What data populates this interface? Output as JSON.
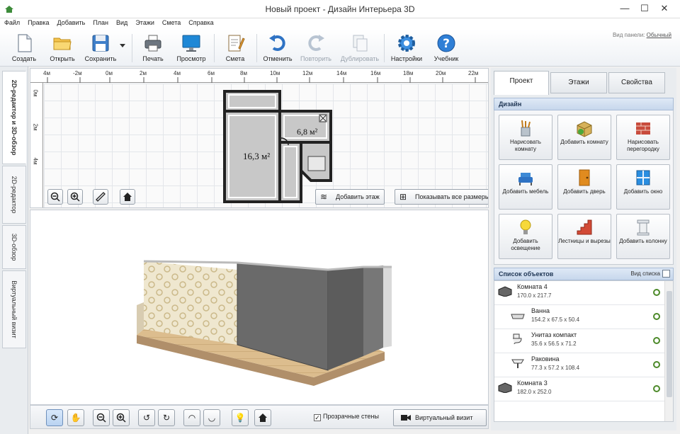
{
  "window": {
    "title": "Новый проект - Дизайн Интерьера 3D",
    "minimize": "—",
    "maximize": "☐",
    "close": "✕"
  },
  "menu": [
    "Файл",
    "Правка",
    "Добавить",
    "План",
    "Вид",
    "Этажи",
    "Смета",
    "Справка"
  ],
  "toolbar": {
    "create": "Создать",
    "open": "Открыть",
    "save": "Сохранить",
    "print": "Печать",
    "preview": "Просмотр",
    "estimate": "Смета",
    "undo": "Отменить",
    "redo": "Повторить",
    "duplicate": "Дублировать",
    "settings": "Настройки",
    "tutorial": "Учебник",
    "panel_view_label": "Вид панели:",
    "panel_view_value": "Обычный"
  },
  "left_tabs": [
    "2D-редактор и 3D-обзор",
    "2D-редактор",
    "3D-обзор",
    "Виртуальный визит"
  ],
  "plan": {
    "ruler_top": [
      "4м",
      "-2м",
      "0м",
      "2м",
      "4м",
      "6м",
      "8м",
      "10м",
      "12м",
      "14м",
      "16м",
      "18м",
      "20м",
      "22м"
    ],
    "ruler_left": [
      "0м",
      "2м",
      "4м"
    ],
    "room_labels": [
      "16,3 м²",
      "6,8 м²"
    ],
    "add_floor": "Добавить этаж",
    "show_all_sizes": "Показывать все размеры"
  },
  "bottom": {
    "transparent_walls": "Прозрачные стены",
    "transparent_walls_checked": "✓",
    "virtual_visit": "Виртуальный визит"
  },
  "right_tabs": [
    "Проект",
    "Этажи",
    "Свойства"
  ],
  "design": {
    "header": "Дизайн",
    "buttons": [
      {
        "label": "Нарисовать комнату"
      },
      {
        "label": "Добавить комнату"
      },
      {
        "label": "Нарисовать перегородку"
      },
      {
        "label": "Добавить мебель"
      },
      {
        "label": "Добавить дверь"
      },
      {
        "label": "Добавить окно"
      },
      {
        "label": "Добавить освещение"
      },
      {
        "label": "Лестницы и вырезы"
      },
      {
        "label": "Добавить колонну"
      }
    ]
  },
  "objects": {
    "header": "Список объектов",
    "list_view": "Вид списка",
    "items": [
      {
        "name": "Комната 4",
        "dims": "170.0 x 217.7"
      },
      {
        "name": "Ванна",
        "dims": "154.2 x 67.5 x 50.4"
      },
      {
        "name": "Унитаз компакт",
        "dims": "35.6 x 56.5 x 71.2"
      },
      {
        "name": "Раковина",
        "dims": "77.3 x 57.2 x 108.4"
      },
      {
        "name": "Комната 3",
        "dims": "182.0 x 252.0"
      }
    ]
  },
  "colors": {
    "accent": "#2f73c4",
    "wall_dark": "#5c5c5c",
    "floor": "#d9b98a",
    "wallpaper": "#efe7cf"
  }
}
